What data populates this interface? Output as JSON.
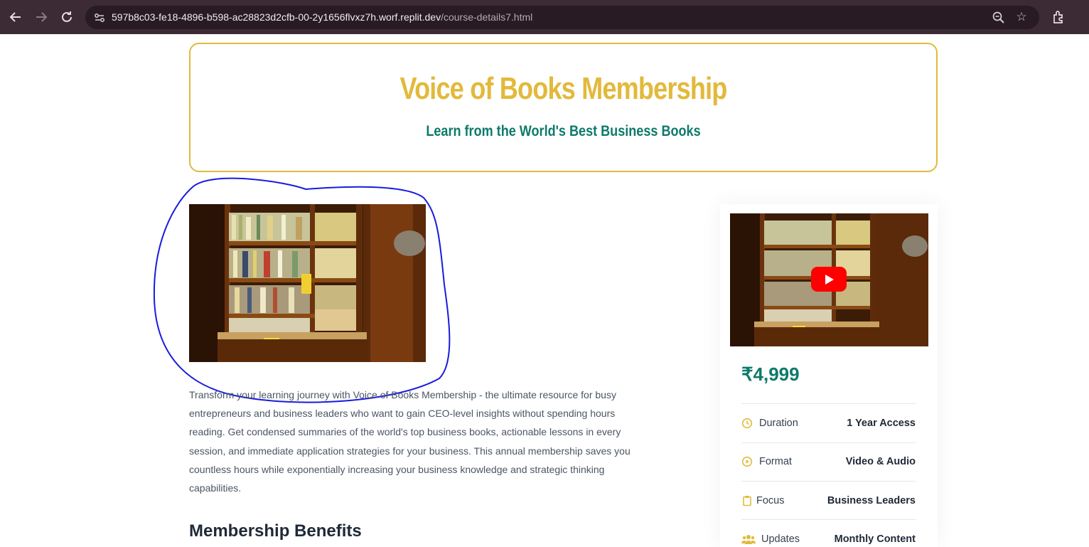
{
  "browser": {
    "url_host": "597b8c03-fe18-4896-b598-ac28823d2cfb-00-2y1656flvxz7h.worf.replit.dev",
    "url_path": "/course-details7.html",
    "icons": [
      "back-icon",
      "forward-icon",
      "reload-icon",
      "site-settings-icon",
      "zoom-icon",
      "bookmark-star-icon",
      "extensions-icon"
    ]
  },
  "hero": {
    "title": "Voice of Books Membership",
    "subtitle": "Learn from the World's Best Business Books"
  },
  "course": {
    "description": "Transform your learning journey with Voice of Books Membership - the ultimate resource for busy entrepreneurs and business leaders who want to gain CEO-level insights without spending hours reading. Get condensed summaries of the world's top business books, actionable lessons in every session, and immediate application strategies for your business. This annual membership saves you countless hours while exponentially increasing your business knowledge and strategic thinking capabilities.",
    "benefits_heading": "Membership Benefits"
  },
  "sidebar": {
    "price": "₹4,999",
    "details": [
      {
        "icon": "clock-icon",
        "label": "Duration",
        "value": "1 Year Access"
      },
      {
        "icon": "play-circle-icon",
        "label": "Format",
        "value": "Video & Audio"
      },
      {
        "icon": "clipboard-icon",
        "label": "Focus",
        "value": "Business Leaders"
      },
      {
        "icon": "users-icon",
        "label": "Updates",
        "value": "Monthly Content"
      }
    ]
  },
  "colors": {
    "accent_gold": "#e2b93b",
    "accent_teal": "#0e7a6b",
    "annotation_stroke": "#1a1adf",
    "video_play": "#ff0000"
  }
}
